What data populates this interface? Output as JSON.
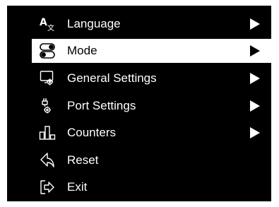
{
  "menu": {
    "items": [
      {
        "label": "Language",
        "icon": "language-icon",
        "has_submenu": true,
        "selected": false
      },
      {
        "label": "Mode",
        "icon": "mode-toggle-icon",
        "has_submenu": true,
        "selected": true
      },
      {
        "label": "General Settings",
        "icon": "general-settings-icon",
        "has_submenu": true,
        "selected": false
      },
      {
        "label": "Port Settings",
        "icon": "port-settings-icon",
        "has_submenu": true,
        "selected": false
      },
      {
        "label": "Counters",
        "icon": "counters-icon",
        "has_submenu": true,
        "selected": false
      },
      {
        "label": "Reset",
        "icon": "reset-icon",
        "has_submenu": false,
        "selected": false
      },
      {
        "label": "Exit",
        "icon": "exit-icon",
        "has_submenu": false,
        "selected": false
      }
    ]
  },
  "colors": {
    "panel_background": "#000000",
    "text": "#ffffff",
    "selected_background": "#ffffff",
    "selected_text": "#000000"
  }
}
